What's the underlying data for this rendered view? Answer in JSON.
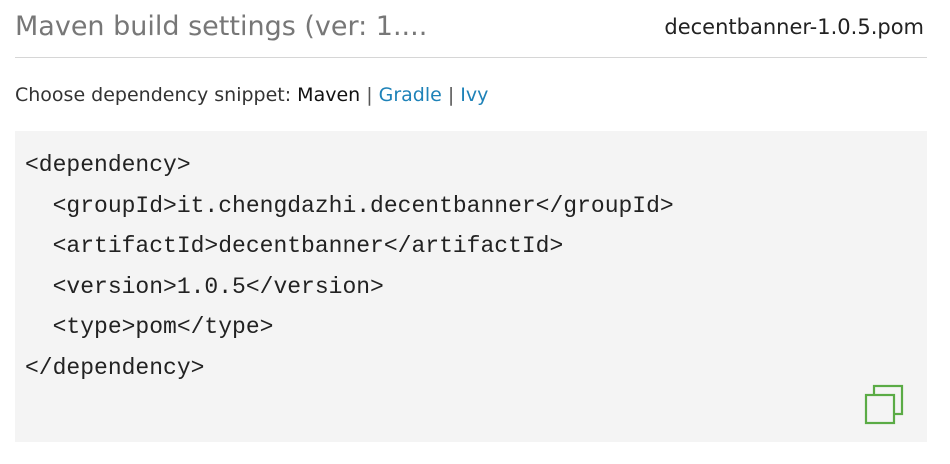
{
  "header": {
    "title": "Maven build settings (ver: 1....",
    "file_name": "decentbanner-1.0.5.pom"
  },
  "chooser": {
    "label": "Choose dependency snippet: ",
    "options": [
      {
        "label": "Maven",
        "active": true
      },
      {
        "label": "Gradle",
        "active": false
      },
      {
        "label": "Ivy",
        "active": false
      }
    ],
    "separator": "|"
  },
  "snippet": {
    "lines": [
      "<dependency>",
      "  <groupId>it.chengdazhi.decentbanner</groupId>",
      "  <artifactId>decentbanner</artifactId>",
      "  <version>1.0.5</version>",
      "  <type>pom</type>",
      "</dependency>"
    ]
  },
  "icons": {
    "copy": "copy-icon"
  },
  "colors": {
    "link": "#1e82b8",
    "copy_icon": "#5aab45",
    "snippet_background": "#f4f4f4",
    "title": "#777777"
  }
}
